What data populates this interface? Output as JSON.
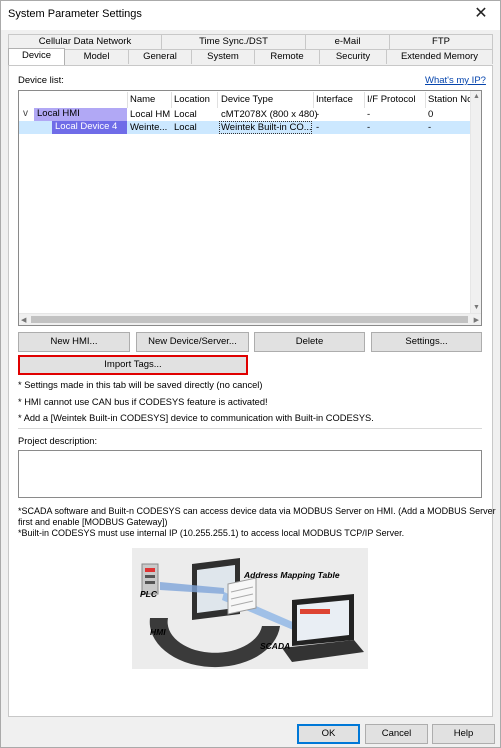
{
  "window": {
    "title": "System Parameter Settings",
    "close_glyph": "✕"
  },
  "tabs_back": [
    "Cellular Data Network",
    "Time Sync./DST",
    "e-Mail",
    "FTP"
  ],
  "tabs_front": [
    "Device",
    "Model",
    "General",
    "System",
    "Remote",
    "Security",
    "Extended Memory"
  ],
  "active_tab": "Device",
  "device_list": {
    "label": "Device list:",
    "whats_my_ip": "What's my IP?",
    "columns": [
      "Name",
      "Location",
      "Device Type",
      "Interface",
      "I/F Protocol",
      "Station No."
    ],
    "rows": [
      {
        "tree": "Local HMI",
        "name": "Local HMI",
        "location": "Local",
        "device_type": "cMT2078X (800 x 480)",
        "interface": "-",
        "protocol": "-",
        "station": "0"
      },
      {
        "tree": "Local Device 4",
        "name": "Weinte...",
        "location": "Local",
        "device_type": "Weintek Built-in CO...",
        "interface": "-",
        "protocol": "-",
        "station": "-"
      }
    ],
    "expand_glyph": "v",
    "scroll_up": "▲",
    "scroll_down": "▼",
    "scroll_left": "◀",
    "scroll_right": "▶"
  },
  "buttons": {
    "new_hmi": "New HMI...",
    "new_device": "New Device/Server...",
    "delete": "Delete",
    "settings": "Settings...",
    "import_tags": "Import Tags..."
  },
  "notes": [
    "* Settings made in this tab will be saved directly (no cancel)",
    "* HMI cannot use CAN bus if CODESYS feature is activated!",
    "* Add a [Weintek Built-in CODESYS] device to communication with Built-in CODESYS."
  ],
  "project_description_label": "Project description:",
  "scada_notes": [
    "*SCADA software and Built-n CODESYS can access device data via MODBUS Server on HMI. (Add a MODBUS Server",
    "first and enable [MODBUS Gateway])",
    "*Built-in CODESYS must use internal IP (10.255.255.1) to access local MODBUS TCP/IP Server."
  ],
  "diagram": {
    "address_mapping": "Address Mapping Table",
    "plc": "PLC",
    "hmi": "HMI",
    "scada": "SCADA"
  },
  "footer": {
    "ok": "OK",
    "cancel": "Cancel",
    "help": "Help"
  }
}
